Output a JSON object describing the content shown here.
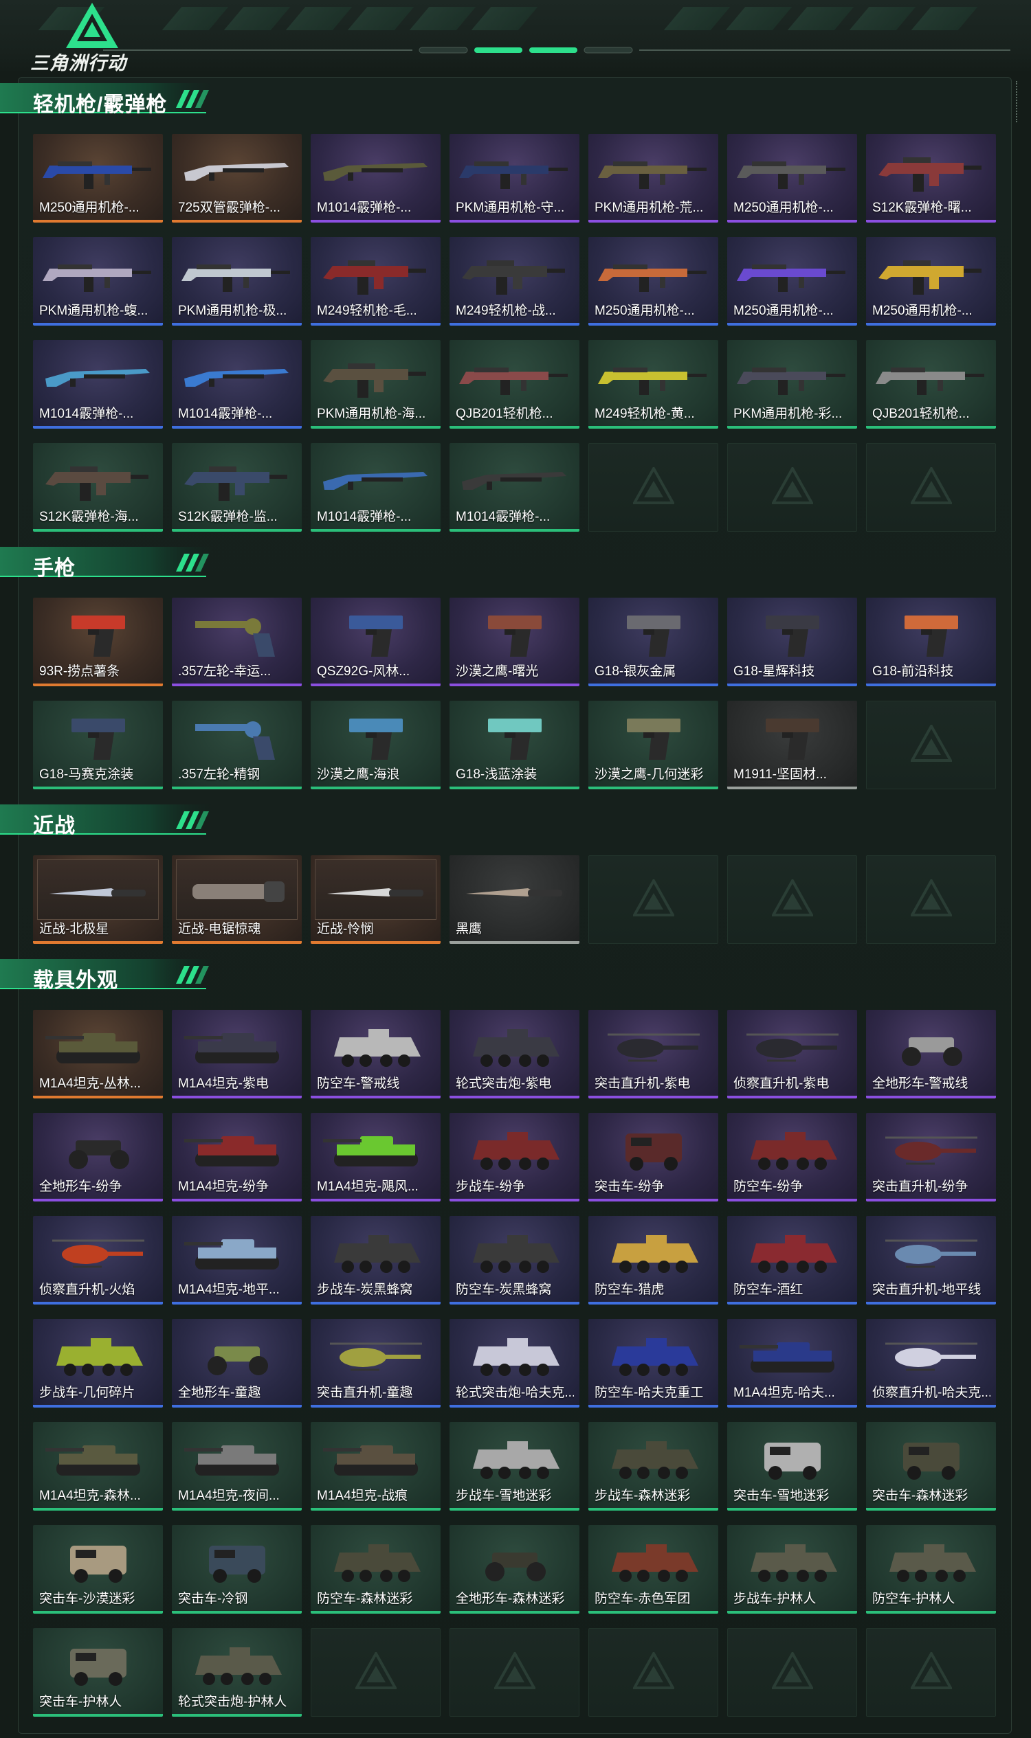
{
  "brand": {
    "name": "三角洲行动",
    "accent": "#2de08c"
  },
  "sections": [
    {
      "title": "轻机枪/霰弹枪",
      "items": [
        {
          "label": "M250通用机枪-...",
          "tier": "orange",
          "kind": "gun",
          "color": "#2a4aa8"
        },
        {
          "label": "725双管霰弹枪-...",
          "tier": "orange",
          "kind": "shotgun",
          "color": "#c8c8d0"
        },
        {
          "label": "M1014霰弹枪-...",
          "tier": "purple",
          "kind": "shotgun",
          "color": "#5a5a3a"
        },
        {
          "label": "PKM通用机枪-守...",
          "tier": "purple",
          "kind": "gun",
          "color": "#2a3a6a"
        },
        {
          "label": "PKM通用机枪-荒...",
          "tier": "purple",
          "kind": "gun",
          "color": "#6a6040"
        },
        {
          "label": "M250通用机枪-...",
          "tier": "purple",
          "kind": "gun",
          "color": "#5a5a5a"
        },
        {
          "label": "S12K霰弹枪-曙...",
          "tier": "purple",
          "kind": "rifle",
          "color": "#8a3a3a"
        },
        {
          "label": "PKM通用机枪-蝮...",
          "tier": "blue",
          "kind": "gun",
          "color": "#b0a8c0"
        },
        {
          "label": "PKM通用机枪-极...",
          "tier": "blue",
          "kind": "gun",
          "color": "#c0c8d0"
        },
        {
          "label": "M249轻机枪-毛...",
          "tier": "blue",
          "kind": "rifle",
          "color": "#8a2a2a"
        },
        {
          "label": "M249轻机枪-战...",
          "tier": "blue",
          "kind": "rifle",
          "color": "#3a3a3a"
        },
        {
          "label": "M250通用机枪-...",
          "tier": "blue",
          "kind": "gun",
          "color": "#c86a3a"
        },
        {
          "label": "M250通用机枪-...",
          "tier": "blue",
          "kind": "gun",
          "color": "#6a4ad0"
        },
        {
          "label": "M250通用机枪-...",
          "tier": "blue",
          "kind": "rifle",
          "color": "#d0a830"
        },
        {
          "label": "M1014霰弹枪-...",
          "tier": "blue",
          "kind": "shotgun",
          "color": "#4a9ac8"
        },
        {
          "label": "M1014霰弹枪-...",
          "tier": "blue",
          "kind": "shotgun",
          "color": "#3a7ad0"
        },
        {
          "label": "PKM通用机枪-海...",
          "tier": "green",
          "kind": "rifle",
          "color": "#5a5040"
        },
        {
          "label": "QJB201轻机枪...",
          "tier": "green",
          "kind": "gun",
          "color": "#8a4a4a"
        },
        {
          "label": "M249轻机枪-黄...",
          "tier": "green",
          "kind": "gun",
          "color": "#c8c030"
        },
        {
          "label": "PKM通用机枪-彩...",
          "tier": "green",
          "kind": "gun",
          "color": "#4a4a5a"
        },
        {
          "label": "QJB201轻机枪...",
          "tier": "green",
          "kind": "gun",
          "color": "#8a8a8a"
        },
        {
          "label": "S12K霰弹枪-海...",
          "tier": "green",
          "kind": "rifle",
          "color": "#5a4a40"
        },
        {
          "label": "S12K霰弹枪-监...",
          "tier": "green",
          "kind": "rifle",
          "color": "#3a4a6a"
        },
        {
          "label": "M1014霰弹枪-...",
          "tier": "green",
          "kind": "shotgun",
          "color": "#3a6ab0"
        },
        {
          "label": "M1014霰弹枪-...",
          "tier": "green",
          "kind": "shotgun",
          "color": "#3a3a3a"
        },
        {
          "label": "",
          "tier": "empty"
        },
        {
          "label": "",
          "tier": "empty"
        },
        {
          "label": "",
          "tier": "empty"
        }
      ]
    },
    {
      "title": "手枪",
      "items": [
        {
          "label": "93R-捞点薯条",
          "tier": "orange",
          "kind": "pistol",
          "color": "#c83a2a"
        },
        {
          "label": ".357左轮-幸运...",
          "tier": "purple",
          "kind": "revolver",
          "color": "#7a7a3a"
        },
        {
          "label": "QSZ92G-风林...",
          "tier": "purple",
          "kind": "pistol",
          "color": "#3a5a9a"
        },
        {
          "label": "沙漠之鹰-曙光",
          "tier": "purple",
          "kind": "pistol",
          "color": "#8a4a3a"
        },
        {
          "label": "G18-银灰金属",
          "tier": "blue",
          "kind": "pistol",
          "color": "#6a6a70"
        },
        {
          "label": "G18-星辉科技",
          "tier": "blue",
          "kind": "pistol",
          "color": "#3a3a44"
        },
        {
          "label": "G18-前沿科技",
          "tier": "blue",
          "kind": "pistol",
          "color": "#d06a3a"
        },
        {
          "label": "G18-马赛克涂装",
          "tier": "green",
          "kind": "pistol",
          "color": "#3a4a6a"
        },
        {
          "label": ".357左轮-精钢",
          "tier": "green",
          "kind": "revolver",
          "color": "#4a7ab0"
        },
        {
          "label": "沙漠之鹰-海浪",
          "tier": "green",
          "kind": "pistol",
          "color": "#4a8ab8"
        },
        {
          "label": "G18-浅蓝涂装",
          "tier": "green",
          "kind": "pistol",
          "color": "#70c8c0"
        },
        {
          "label": "沙漠之鹰-几何迷彩",
          "tier": "green",
          "kind": "pistol",
          "color": "#7a7a5a"
        },
        {
          "label": "M1911-坚固材...",
          "tier": "grey",
          "kind": "pistol",
          "color": "#4a3a30"
        },
        {
          "label": "",
          "tier": "empty"
        }
      ]
    },
    {
      "title": "近战",
      "items": [
        {
          "label": "近战-北极星",
          "tier": "orange",
          "kind": "knife",
          "color": "#c0c8d8"
        },
        {
          "label": "近战-电锯惊魂",
          "tier": "orange",
          "kind": "saw",
          "color": "#8a8078"
        },
        {
          "label": "近战-怜悯",
          "tier": "orange",
          "kind": "knife",
          "color": "#d8d8d8"
        },
        {
          "label": "黑鹰",
          "tier": "grey",
          "kind": "knife",
          "color": "#b0a090"
        },
        {
          "label": "",
          "tier": "empty"
        },
        {
          "label": "",
          "tier": "empty"
        },
        {
          "label": "",
          "tier": "empty"
        }
      ]
    },
    {
      "title": "载具外观",
      "items": [
        {
          "label": "M1A4坦克-丛林...",
          "tier": "orange",
          "kind": "tank",
          "color": "#5a5a3a"
        },
        {
          "label": "M1A4坦克-紫电",
          "tier": "purple",
          "kind": "tank",
          "color": "#3a3a4a"
        },
        {
          "label": "防空车-警戒线",
          "tier": "purple",
          "kind": "apc",
          "color": "#b8b8b8"
        },
        {
          "label": "轮式突击炮-紫电",
          "tier": "purple",
          "kind": "apc",
          "color": "#3a3a44"
        },
        {
          "label": "突击直升机-紫电",
          "tier": "purple",
          "kind": "heli",
          "color": "#2a2a30"
        },
        {
          "label": "侦察直升机-紫电",
          "tier": "purple",
          "kind": "heli",
          "color": "#2a2a30"
        },
        {
          "label": "全地形车-警戒线",
          "tier": "purple",
          "kind": "atv",
          "color": "#9a9a9a"
        },
        {
          "label": "全地形车-纷争",
          "tier": "purple",
          "kind": "atv",
          "color": "#2a2a2a"
        },
        {
          "label": "M1A4坦克-纷争",
          "tier": "purple",
          "kind": "tank",
          "color": "#8a2a2a"
        },
        {
          "label": "M1A4坦克-飓风...",
          "tier": "purple",
          "kind": "tank",
          "color": "#6ac830"
        },
        {
          "label": "步战车-纷争",
          "tier": "purple",
          "kind": "apc",
          "color": "#7a2a2a"
        },
        {
          "label": "突击车-纷争",
          "tier": "purple",
          "kind": "truck",
          "color": "#5a2a2a"
        },
        {
          "label": "防空车-纷争",
          "tier": "purple",
          "kind": "apc",
          "color": "#7a2a2a"
        },
        {
          "label": "突击直升机-纷争",
          "tier": "purple",
          "kind": "heli",
          "color": "#6a2a2a"
        },
        {
          "label": "侦察直升机-火焰",
          "tier": "blue",
          "kind": "heli",
          "color": "#c04020"
        },
        {
          "label": "M1A4坦克-地平...",
          "tier": "blue",
          "kind": "tank",
          "color": "#8aa8c8"
        },
        {
          "label": "步战车-炭黑蜂窝",
          "tier": "blue",
          "kind": "apc",
          "color": "#3a3a3a"
        },
        {
          "label": "防空车-炭黑蜂窝",
          "tier": "blue",
          "kind": "apc",
          "color": "#3a3a3a"
        },
        {
          "label": "防空车-猎虎",
          "tier": "blue",
          "kind": "apc",
          "color": "#c8a040"
        },
        {
          "label": "防空车-酒红",
          "tier": "blue",
          "kind": "apc",
          "color": "#8a2a30"
        },
        {
          "label": "突击直升机-地平线",
          "tier": "blue",
          "kind": "heli",
          "color": "#6a8ab0"
        },
        {
          "label": "步战车-几何碎片",
          "tier": "blue",
          "kind": "apc",
          "color": "#9ab030"
        },
        {
          "label": "全地形车-童趣",
          "tier": "blue",
          "kind": "atv",
          "color": "#7a8a4a"
        },
        {
          "label": "突击直升机-童趣",
          "tier": "blue",
          "kind": "heli",
          "color": "#a0a040"
        },
        {
          "label": "轮式突击炮-哈夫克...",
          "tier": "blue",
          "kind": "apc",
          "color": "#c8c8d8"
        },
        {
          "label": "防空车-哈夫克重工",
          "tier": "blue",
          "kind": "apc",
          "color": "#2a3a9a"
        },
        {
          "label": "M1A4坦克-哈夫...",
          "tier": "blue",
          "kind": "tank",
          "color": "#2a3a8a"
        },
        {
          "label": "侦察直升机-哈夫克...",
          "tier": "blue",
          "kind": "heli",
          "color": "#d0d0e0"
        },
        {
          "label": "M1A4坦克-森林...",
          "tier": "green",
          "kind": "tank",
          "color": "#5a5a40"
        },
        {
          "label": "M1A4坦克-夜间...",
          "tier": "green",
          "kind": "tank",
          "color": "#7a7a7a"
        },
        {
          "label": "M1A4坦克-战痕",
          "tier": "green",
          "kind": "tank",
          "color": "#5a5040"
        },
        {
          "label": "步战车-雪地迷彩",
          "tier": "green",
          "kind": "apc",
          "color": "#a8a8a8"
        },
        {
          "label": "步战车-森林迷彩",
          "tier": "green",
          "kind": "apc",
          "color": "#4a4a3a"
        },
        {
          "label": "突击车-雪地迷彩",
          "tier": "green",
          "kind": "truck",
          "color": "#b0b0b0"
        },
        {
          "label": "突击车-森林迷彩",
          "tier": "green",
          "kind": "truck",
          "color": "#4a4a3a"
        },
        {
          "label": "突击车-沙漠迷彩",
          "tier": "green",
          "kind": "truck",
          "color": "#a89a80"
        },
        {
          "label": "突击车-冷钢",
          "tier": "green",
          "kind": "truck",
          "color": "#3a4a5a"
        },
        {
          "label": "防空车-森林迷彩",
          "tier": "green",
          "kind": "apc",
          "color": "#4a4a3a"
        },
        {
          "label": "全地形车-森林迷彩",
          "tier": "green",
          "kind": "atv",
          "color": "#3a3a30"
        },
        {
          "label": "防空车-赤色军团",
          "tier": "green",
          "kind": "apc",
          "color": "#7a3a2a"
        },
        {
          "label": "步战车-护林人",
          "tier": "green",
          "kind": "apc",
          "color": "#5a5a4a"
        },
        {
          "label": "防空车-护林人",
          "tier": "green",
          "kind": "apc",
          "color": "#5a5a4a"
        },
        {
          "label": "突击车-护林人",
          "tier": "green",
          "kind": "truck",
          "color": "#6a6a5a"
        },
        {
          "label": "轮式突击炮-护林人",
          "tier": "green",
          "kind": "apc",
          "color": "#5a5a4a"
        },
        {
          "label": "",
          "tier": "empty"
        },
        {
          "label": "",
          "tier": "empty"
        },
        {
          "label": "",
          "tier": "empty"
        },
        {
          "label": "",
          "tier": "empty"
        },
        {
          "label": "",
          "tier": "empty"
        }
      ]
    }
  ]
}
